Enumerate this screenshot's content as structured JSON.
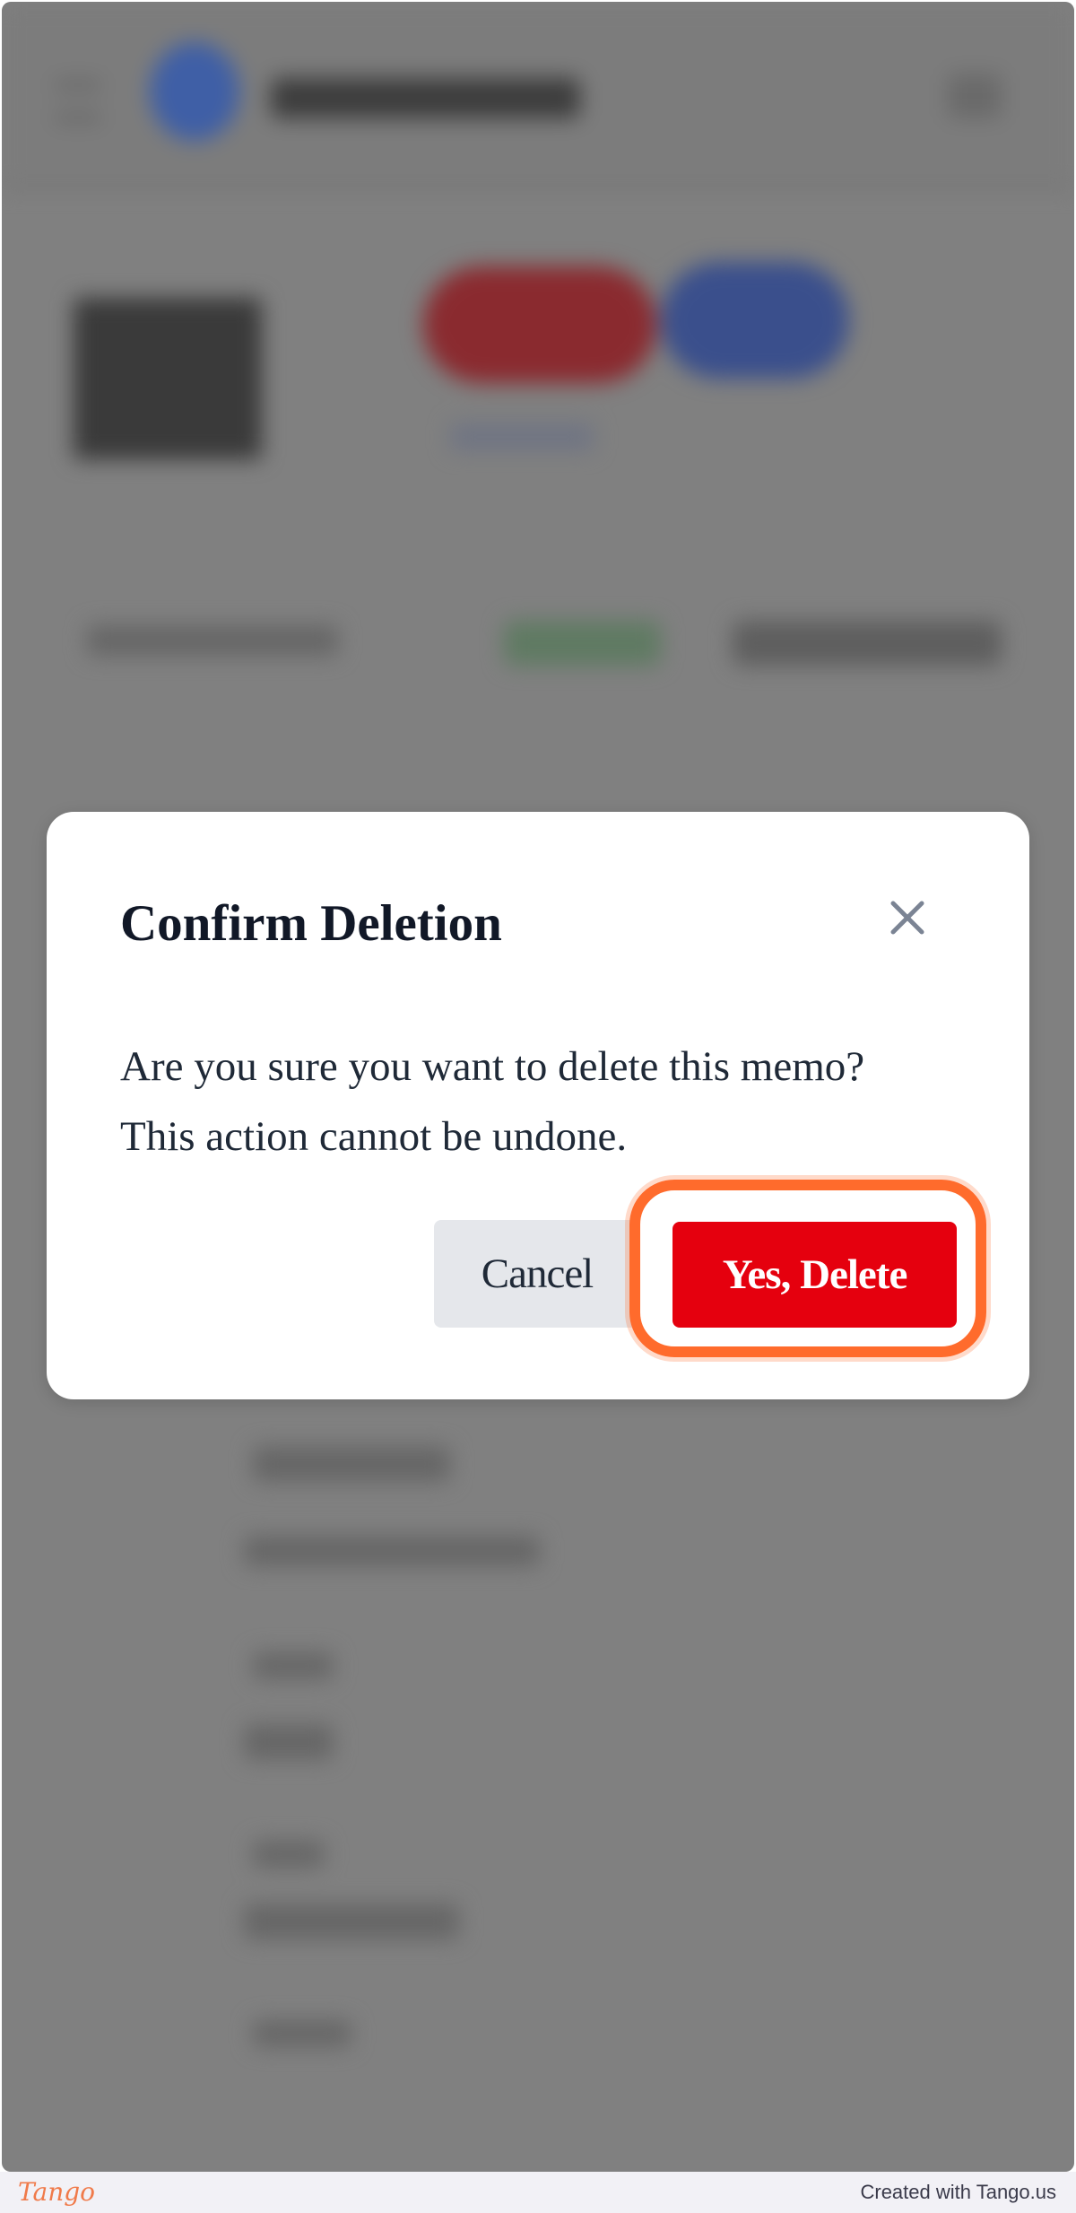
{
  "dialog": {
    "title": "Confirm Deletion",
    "message": "Are you sure you want to delete this memo? This action cannot be undone.",
    "cancel_label": "Cancel",
    "confirm_label": "Yes, Delete",
    "close_icon": "close-icon"
  },
  "footer": {
    "logo": "Tango",
    "credit": "Created with Tango.us"
  },
  "colors": {
    "confirm_button": "#e5000e",
    "cancel_button": "#e5e7eb",
    "highlight": "#ff6b2c",
    "overlay": "#808080"
  }
}
